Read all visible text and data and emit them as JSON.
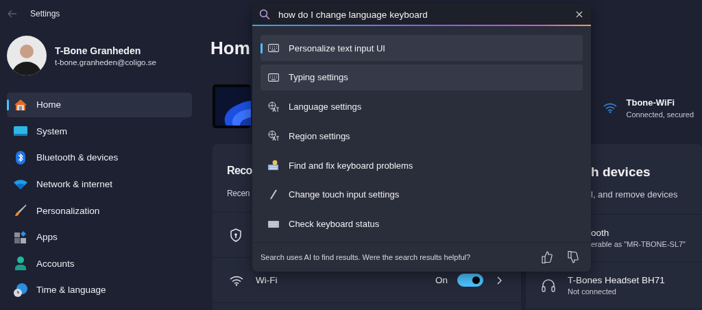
{
  "window": {
    "title": "Settings"
  },
  "profile": {
    "name": "T-Bone Granheden",
    "email": "t-bone.granheden@coligo.se"
  },
  "nav": [
    {
      "label": "Home",
      "selected": true
    },
    {
      "label": "System",
      "selected": false
    },
    {
      "label": "Bluetooth & devices",
      "selected": false
    },
    {
      "label": "Network & internet",
      "selected": false
    },
    {
      "label": "Personalization",
      "selected": false
    },
    {
      "label": "Apps",
      "selected": false
    },
    {
      "label": "Accounts",
      "selected": false
    },
    {
      "label": "Time & language",
      "selected": false
    }
  ],
  "page": {
    "title": "Hom"
  },
  "network": {
    "name": "Tbone-WiFi",
    "status": "Connected, secured"
  },
  "recommended": {
    "title": "Reco",
    "subtitle": "Recen",
    "rows": [
      {
        "kind": "shield"
      },
      {
        "kind": "wifi",
        "label": "Wi-Fi",
        "state": "On",
        "on": true
      }
    ]
  },
  "devices": {
    "title": "h devices",
    "subtitle": "l, and remove devices",
    "rows": [
      {
        "kind": "bluetooth",
        "label": "ooth",
        "detail": "erable as \"MR-TBONE-SL7\""
      },
      {
        "kind": "headset",
        "label": "T-Bones Headset BH71",
        "detail": "Not connected"
      }
    ]
  },
  "search": {
    "value": "how do I change language keyboard",
    "results": [
      {
        "kind": "keyboard",
        "label": "Personalize text input UI",
        "selected": true,
        "highlighted": true
      },
      {
        "kind": "keyboard",
        "label": "Typing settings",
        "selected": false,
        "highlighted": true
      },
      {
        "kind": "language",
        "label": "Language settings",
        "selected": false,
        "highlighted": false
      },
      {
        "kind": "language",
        "label": "Region settings",
        "selected": false,
        "highlighted": false
      },
      {
        "kind": "troubleshoot",
        "label": "Find and fix keyboard problems",
        "selected": false,
        "highlighted": false
      },
      {
        "kind": "pen",
        "label": "Change touch input settings",
        "selected": false,
        "highlighted": false
      },
      {
        "kind": "keyboard-flat",
        "label": "Check keyboard status",
        "selected": false,
        "highlighted": false
      }
    ],
    "footer": "Search uses AI to find results. Were the search results helpful?"
  }
}
